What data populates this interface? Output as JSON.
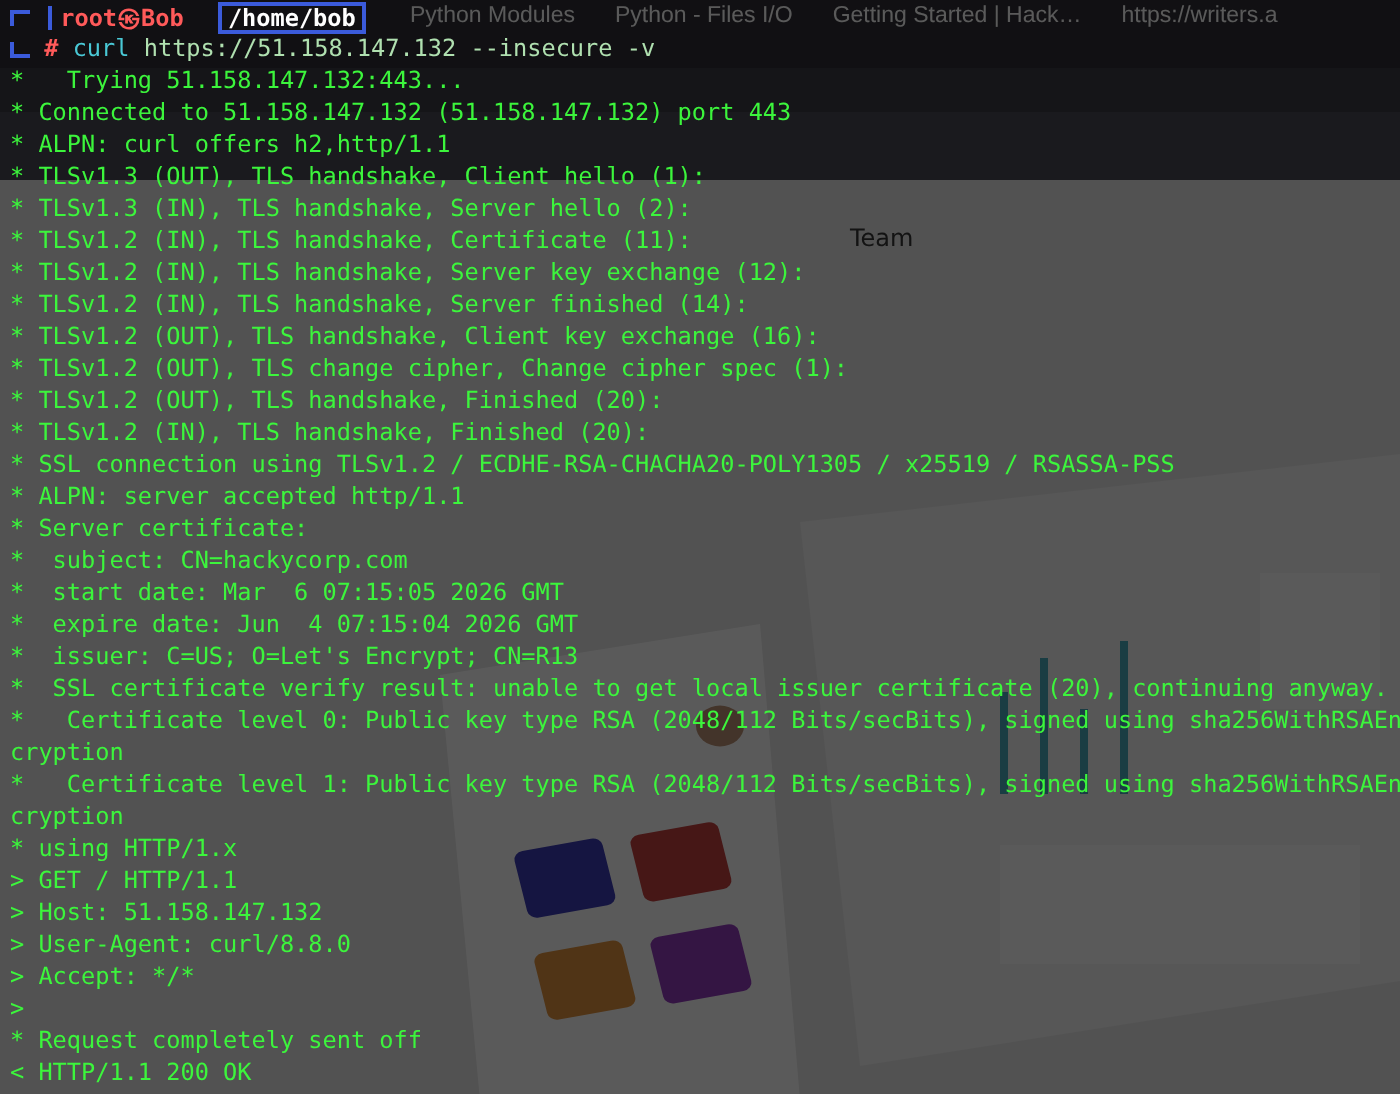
{
  "browser": {
    "tabs": [
      {
        "label": "Python Modules"
      },
      {
        "label": "Python - Files I/O"
      },
      {
        "label": "Getting Started | Hack…"
      },
      {
        "label": "https://writers.a"
      }
    ],
    "page": {
      "nav_label": "Team",
      "kind": "picture"
    }
  },
  "terminal": {
    "prompt": {
      "user": "root㉿Bob",
      "cwd": "/home/bob",
      "symbol": "#",
      "command": "curl",
      "args": "https://51.158.147.132 --insecure -v"
    },
    "lines": [
      "*   Trying 51.158.147.132:443...",
      "* Connected to 51.158.147.132 (51.158.147.132) port 443",
      "* ALPN: curl offers h2,http/1.1",
      "* TLSv1.3 (OUT), TLS handshake, Client hello (1):",
      "* TLSv1.3 (IN), TLS handshake, Server hello (2):",
      "* TLSv1.2 (IN), TLS handshake, Certificate (11):",
      "* TLSv1.2 (IN), TLS handshake, Server key exchange (12):",
      "* TLSv1.2 (IN), TLS handshake, Server finished (14):",
      "* TLSv1.2 (OUT), TLS handshake, Client key exchange (16):",
      "* TLSv1.2 (OUT), TLS change cipher, Change cipher spec (1):",
      "* TLSv1.2 (OUT), TLS handshake, Finished (20):",
      "* TLSv1.2 (IN), TLS handshake, Finished (20):",
      "* SSL connection using TLSv1.2 / ECDHE-RSA-CHACHA20-POLY1305 / x25519 / RSASSA-PSS",
      "* ALPN: server accepted http/1.1",
      "* Server certificate:",
      "*  subject: CN=hackycorp.com",
      "*  start date: Mar  6 07:15:05 2026 GMT",
      "*  expire date: Jun  4 07:15:04 2026 GMT",
      "*  issuer: C=US; O=Let's Encrypt; CN=R13",
      "*  SSL certificate verify result: unable to get local issuer certificate (20), continuing anyway.",
      "*   Certificate level 0: Public key type RSA (2048/112 Bits/secBits), signed using sha256WithRSAEn",
      "cryption",
      "*   Certificate level 1: Public key type RSA (2048/112 Bits/secBits), signed using sha256WithRSAEn",
      "cryption",
      "* using HTTP/1.x",
      "> GET / HTTP/1.1",
      "> Host: 51.158.147.132",
      "> User-Agent: curl/8.8.0",
      "> Accept: */*",
      ">",
      "* Request completely sent off",
      "< HTTP/1.1 200 OK"
    ]
  }
}
